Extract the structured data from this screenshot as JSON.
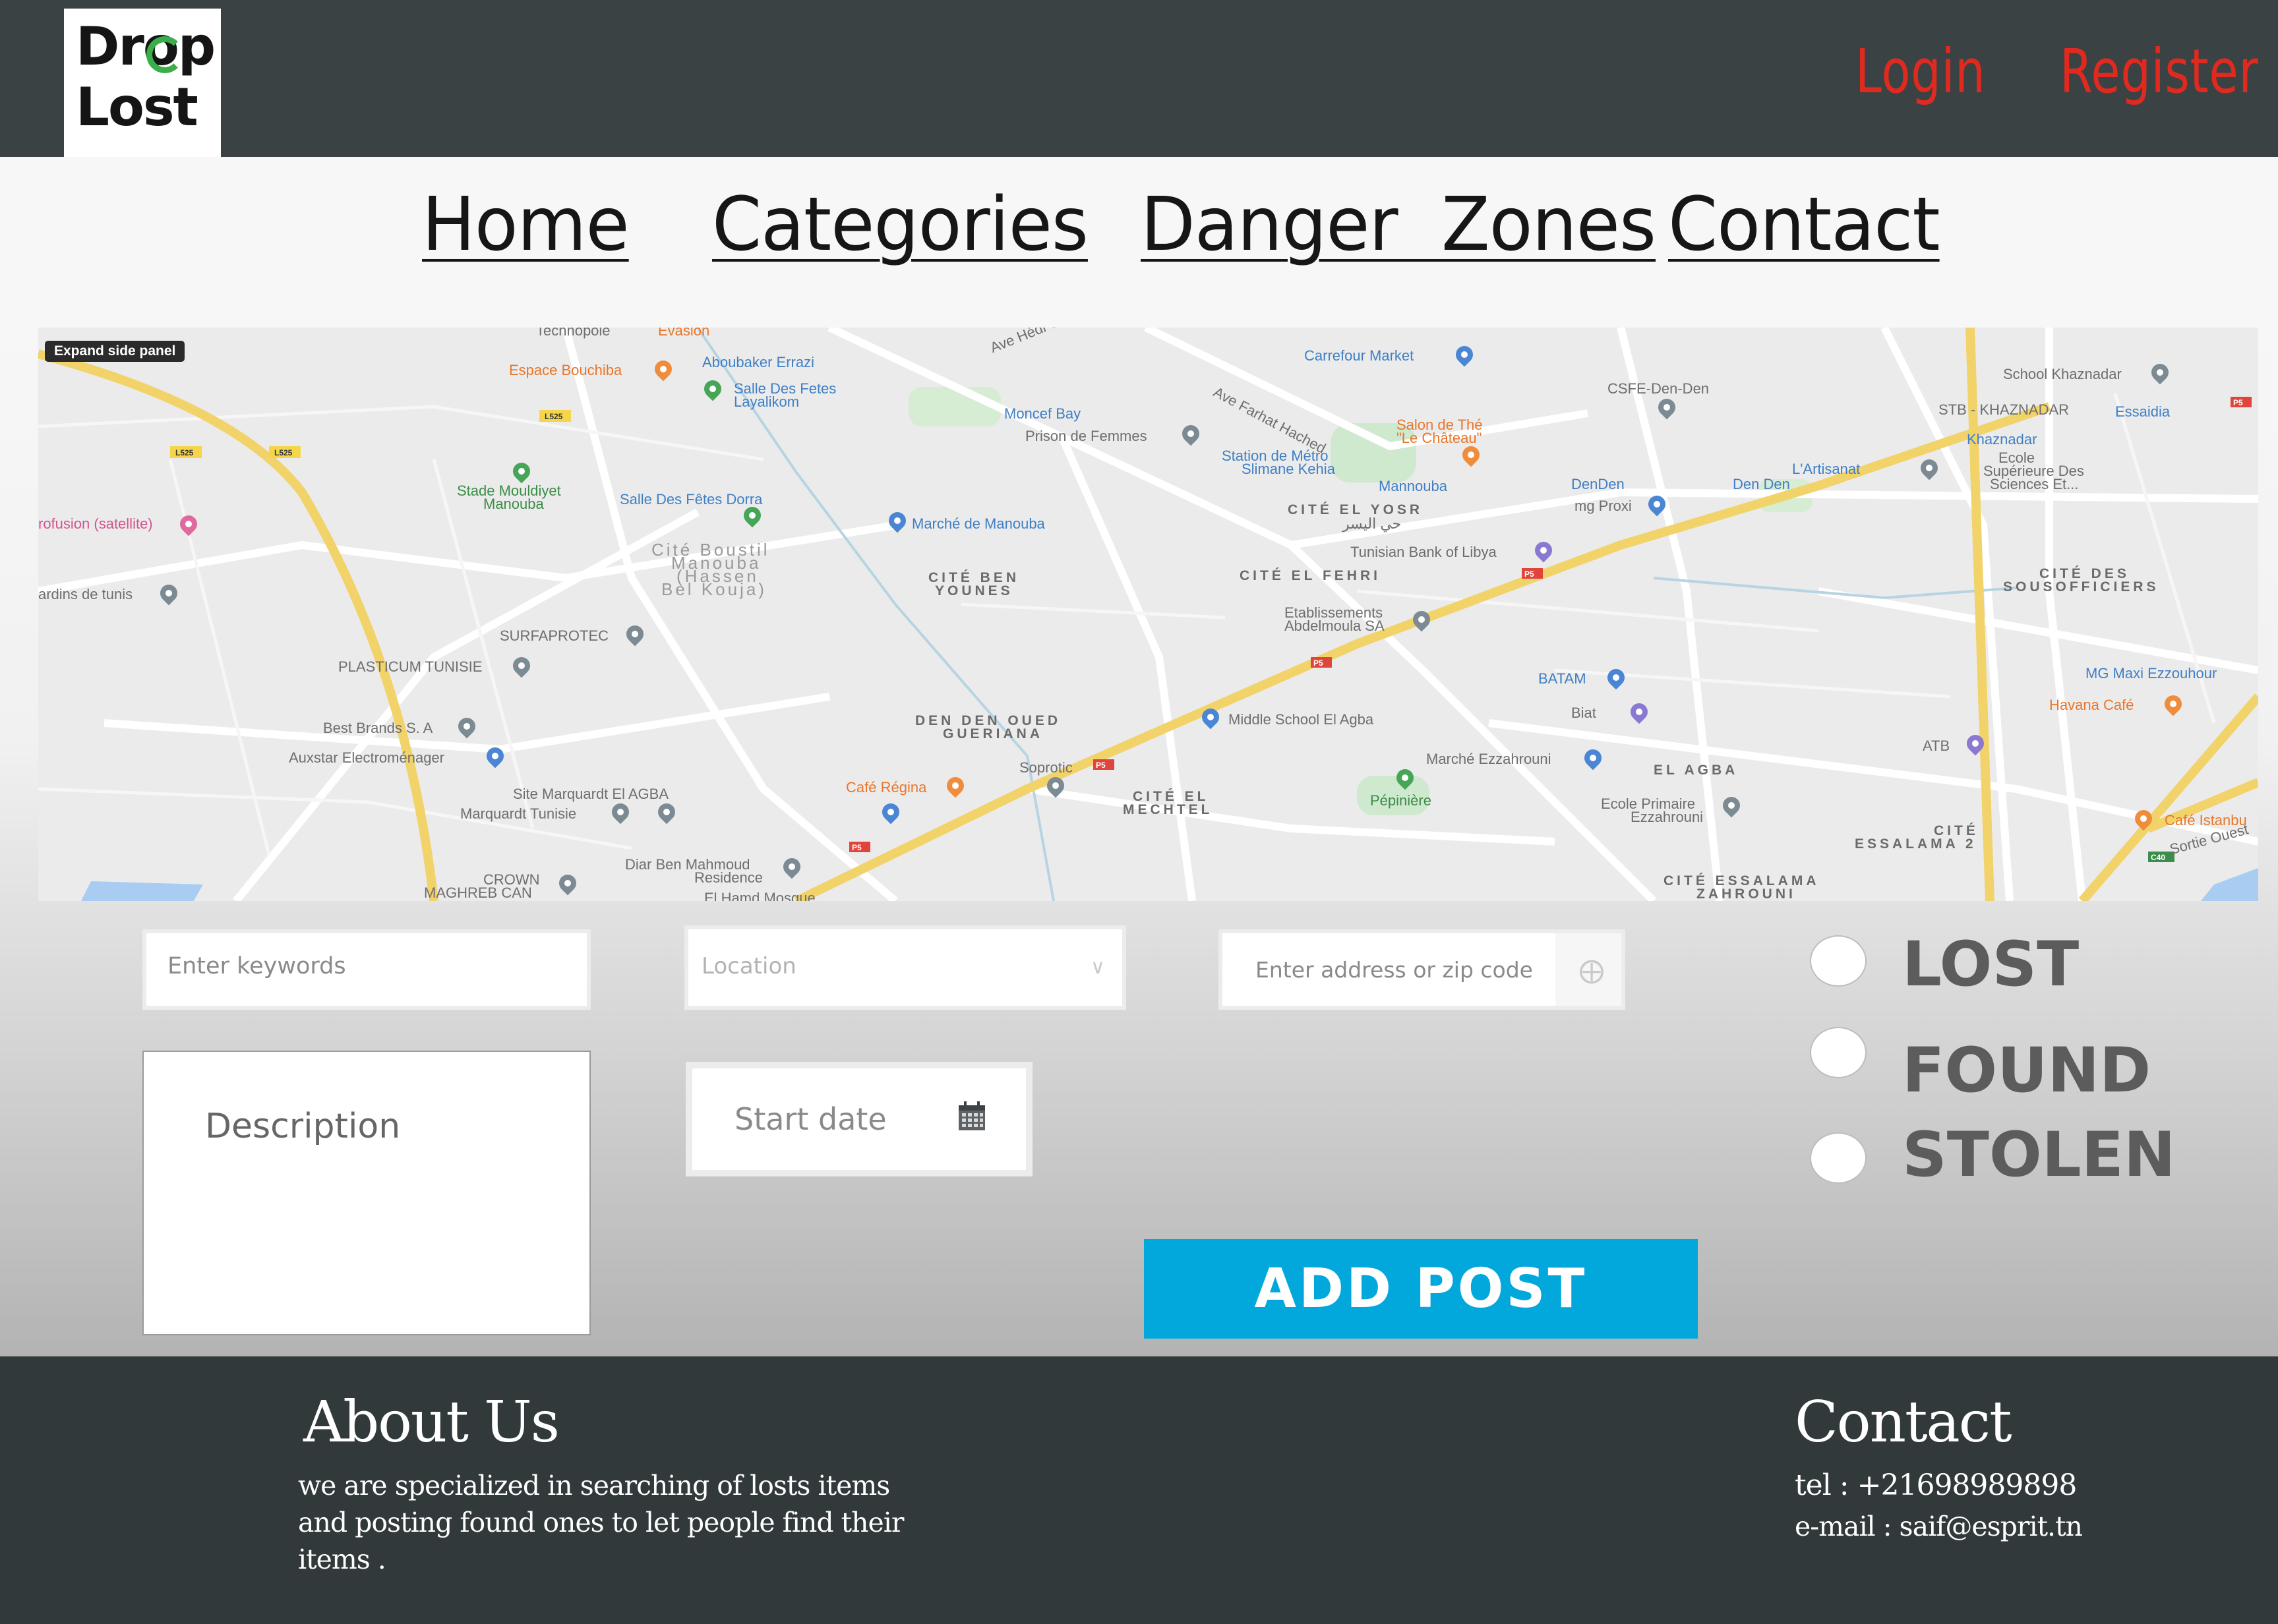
{
  "header": {
    "logo_line1": "Drop",
    "logo_line2": "Lost",
    "login": "Login",
    "register": "Register",
    "accent_color": "#e02a1f",
    "logo_ring_color": "#3aae4a"
  },
  "nav": {
    "items": [
      "Home",
      "Categories",
      "Danger  Zones",
      "Contact"
    ]
  },
  "map": {
    "expand_label": "Expand side panel",
    "labels": {
      "technopole": "Technopole",
      "evasion": "Evasion",
      "aboubaker": "Aboubaker Errazi",
      "espace_bouchiba": "Espace Bouchiba",
      "salle_fetes": "Salle Des Fetes",
      "layalikom": "Layalikom",
      "moncef_bay": "Moncef Bay",
      "prison": "Prison de Femmes",
      "carrefour": "Carrefour Market",
      "school_khaznadar": "School Khaznadar",
      "csfe": "CSFE-Den-Den",
      "stb": "STB - KHAZNADAR",
      "essaidia": "Essaidia",
      "khaznadar": "Khaznadar",
      "ecole_sup": "Ecole",
      "ecole_sup2": "Supérieure Des",
      "ecole_sup3": "Sciences Et...",
      "salon_the": "Salon de Thé",
      "chateau": "\"Le Château\"",
      "station_metro": "Station de Métro",
      "slimane": "Slimane Kehia",
      "mannouba": "Mannouba",
      "denden": "DenDen",
      "den_den": "Den Den",
      "artisanat": "L'Artisanat",
      "mg_proxi": "mg Proxi",
      "stade": "Stade Mouldiyet",
      "stade2": "Manouba",
      "salle_dorra": "Salle Des Fêtes Dorra",
      "marche_manouba": "Marché de Manouba",
      "cite_yosr": "CITÉ EL YOSR",
      "cite_yosr_ar": "حي اليسر",
      "tunisian_bank": "Tunisian Bank of Libya",
      "profusion": "rofusion (satellite)",
      "jardins": "ardins de tunis",
      "cite_boustil": "Cité Boustil",
      "cite_boustil2": "Manouba",
      "cite_boustil3": "(Hassen",
      "cite_boustil4": "Bel Kouja)",
      "cite_ben": "CITÉ BEN",
      "younes": "YOUNES",
      "cite_fehri": "CITÉ EL FEHRI",
      "cite_sous": "CITÉ DES",
      "sousofficiers": "SOUSOFFICIERS",
      "surfaprotec": "SURFAPROTEC",
      "etablissements": "Etablissements",
      "abdelmoula": "Abdelmoula SA",
      "plasticum": "PLASTICUM TUNISIE",
      "batam": "BATAM",
      "mg_maxi": "MG Maxi Ezzouhour",
      "best_brands": "Best Brands S. A",
      "biat": "Biat",
      "havana": "Havana Café",
      "auxstar": "Auxstar Electroménager",
      "den_den_oued": "DEN DEN OUED",
      "gueriana": "GUERIANA",
      "middle_school": "Middle School El Agba",
      "marche_ezzahrouni": "Marché Ezzahrouni",
      "atb": "ATB",
      "sotroctic": "Soprotic",
      "el_agba": "EL AGBA",
      "site_marquardt": "Site Marquardt El AGBA",
      "marquardt": "Marquardt Tunisie",
      "cafe_regina": "Café Régina",
      "cite_mechtel": "CITÉ EL",
      "mechtel": "MECHTEL",
      "pepiniere": "Pépinière",
      "ecole_primaire": "Ecole Primaire",
      "ezzahrouni": "Ezzahrouni",
      "cite_essalama": "CITÉ",
      "essalama2": "ESSALAMA 2",
      "cafe_istanbul": "Café Istanbu",
      "diar_ben": "Diar Ben Mahmoud",
      "residence": "Residence",
      "crown": "CROWN",
      "maghreb": "MAGHREB CAN",
      "el_hamd": "El Hamd Mosque",
      "cite_essalama_z": "CITÉ ESSALAMA",
      "zahrouni": "ZAHROUNI",
      "ave_hedi": "Ave Hédi Chaker",
      "ave_farhat": "Ave Farhat Hached",
      "sortie": "Sortie Ouest"
    }
  },
  "form": {
    "keywords_placeholder": "Enter keywords",
    "location_placeholder": "Location",
    "address_placeholder": "Enter address or zip code",
    "description_placeholder": "Description",
    "start_date_placeholder": "Start date",
    "status_options": [
      "LOST",
      "FOUND",
      "STOLEN"
    ],
    "add_post_label": "ADD POST",
    "button_color": "#02a8dc"
  },
  "footer": {
    "about_title": "About Us",
    "about_text_lines": [
      "we are specialized in searching of losts items",
      "and posting found ones to let people find their",
      "items ."
    ],
    "contact_title": "Contact",
    "tel": "tel : +21698989898",
    "email": "e-mail : saif@esprit.tn"
  }
}
